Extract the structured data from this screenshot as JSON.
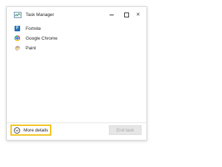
{
  "window": {
    "title": "Task Manager",
    "app_icon": "task-manager-icon",
    "controls": {
      "minimize_icon": "minimize-icon",
      "maximize_icon": "maximize-icon",
      "close_glyph": "✕"
    }
  },
  "processes": [
    {
      "label": "Fortnite",
      "icon": "fortnite-icon"
    },
    {
      "label": "Google Chrome",
      "icon": "chrome-icon"
    },
    {
      "label": "Paint",
      "icon": "paint-icon"
    }
  ],
  "footer": {
    "more_details_label": "More details",
    "end_task_label": "End task",
    "end_task_enabled": false
  },
  "colors": {
    "highlight": "#f2c21b",
    "fortnite_blue": "#1f6fb8",
    "disabled_text": "#a8a8a8"
  }
}
